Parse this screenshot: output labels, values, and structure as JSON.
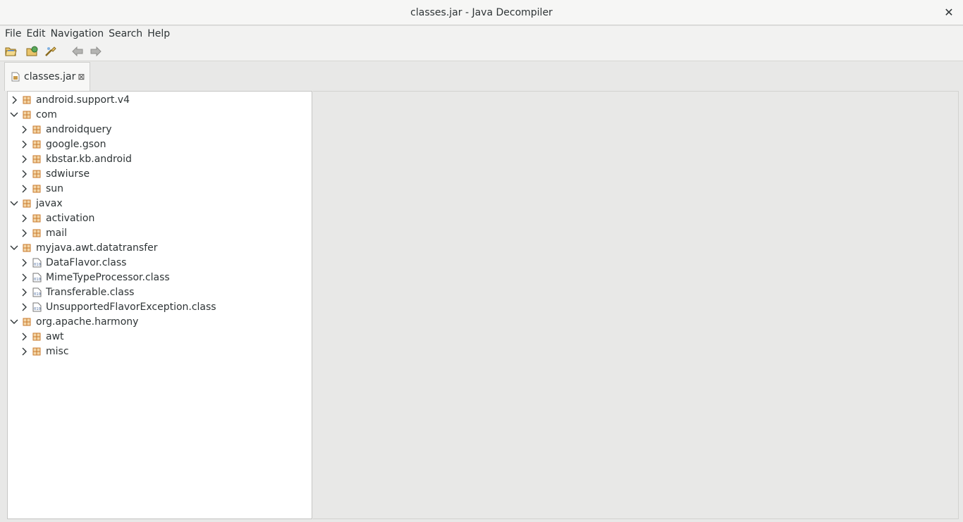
{
  "window": {
    "title": "classes.jar - Java Decompiler",
    "close_glyph": "✕"
  },
  "menu": [
    "File",
    "Edit",
    "Navigation",
    "Search",
    "Help"
  ],
  "toolbar": [
    "open-file-icon",
    "open-type-icon",
    "open-type-hierarchy-icon",
    "back-icon",
    "forward-icon"
  ],
  "tab": {
    "label": "classes.jar",
    "close_glyph": "⊠"
  },
  "tree": [
    {
      "label": "android.support.v4",
      "depth": 0,
      "expanded": false,
      "icon": "package-icon"
    },
    {
      "label": "com",
      "depth": 0,
      "expanded": true,
      "icon": "package-icon"
    },
    {
      "label": "androidquery",
      "depth": 1,
      "expanded": false,
      "icon": "package-icon"
    },
    {
      "label": "google.gson",
      "depth": 1,
      "expanded": false,
      "icon": "package-icon"
    },
    {
      "label": "kbstar.kb.android",
      "depth": 1,
      "expanded": false,
      "icon": "package-icon"
    },
    {
      "label": "sdwiurse",
      "depth": 1,
      "expanded": false,
      "icon": "package-icon"
    },
    {
      "label": "sun",
      "depth": 1,
      "expanded": false,
      "icon": "package-icon"
    },
    {
      "label": "javax",
      "depth": 0,
      "expanded": true,
      "icon": "package-icon"
    },
    {
      "label": "activation",
      "depth": 1,
      "expanded": false,
      "icon": "package-icon"
    },
    {
      "label": "mail",
      "depth": 1,
      "expanded": false,
      "icon": "package-icon"
    },
    {
      "label": "myjava.awt.datatransfer",
      "depth": 0,
      "expanded": true,
      "icon": "package-icon"
    },
    {
      "label": "DataFlavor.class",
      "depth": 1,
      "expanded": false,
      "icon": "class-file-icon"
    },
    {
      "label": "MimeTypeProcessor.class",
      "depth": 1,
      "expanded": false,
      "icon": "class-file-icon"
    },
    {
      "label": "Transferable.class",
      "depth": 1,
      "expanded": false,
      "icon": "class-file-icon"
    },
    {
      "label": "UnsupportedFlavorException.class",
      "depth": 1,
      "expanded": false,
      "icon": "class-file-icon"
    },
    {
      "label": "org.apache.harmony",
      "depth": 0,
      "expanded": true,
      "icon": "package-icon"
    },
    {
      "label": "awt",
      "depth": 1,
      "expanded": false,
      "icon": "package-icon"
    },
    {
      "label": "misc",
      "depth": 1,
      "expanded": false,
      "icon": "package-icon"
    }
  ],
  "colors": {
    "package": "#c87a2c",
    "class_file": "#5a78a8",
    "chevron": "#2e3436"
  }
}
